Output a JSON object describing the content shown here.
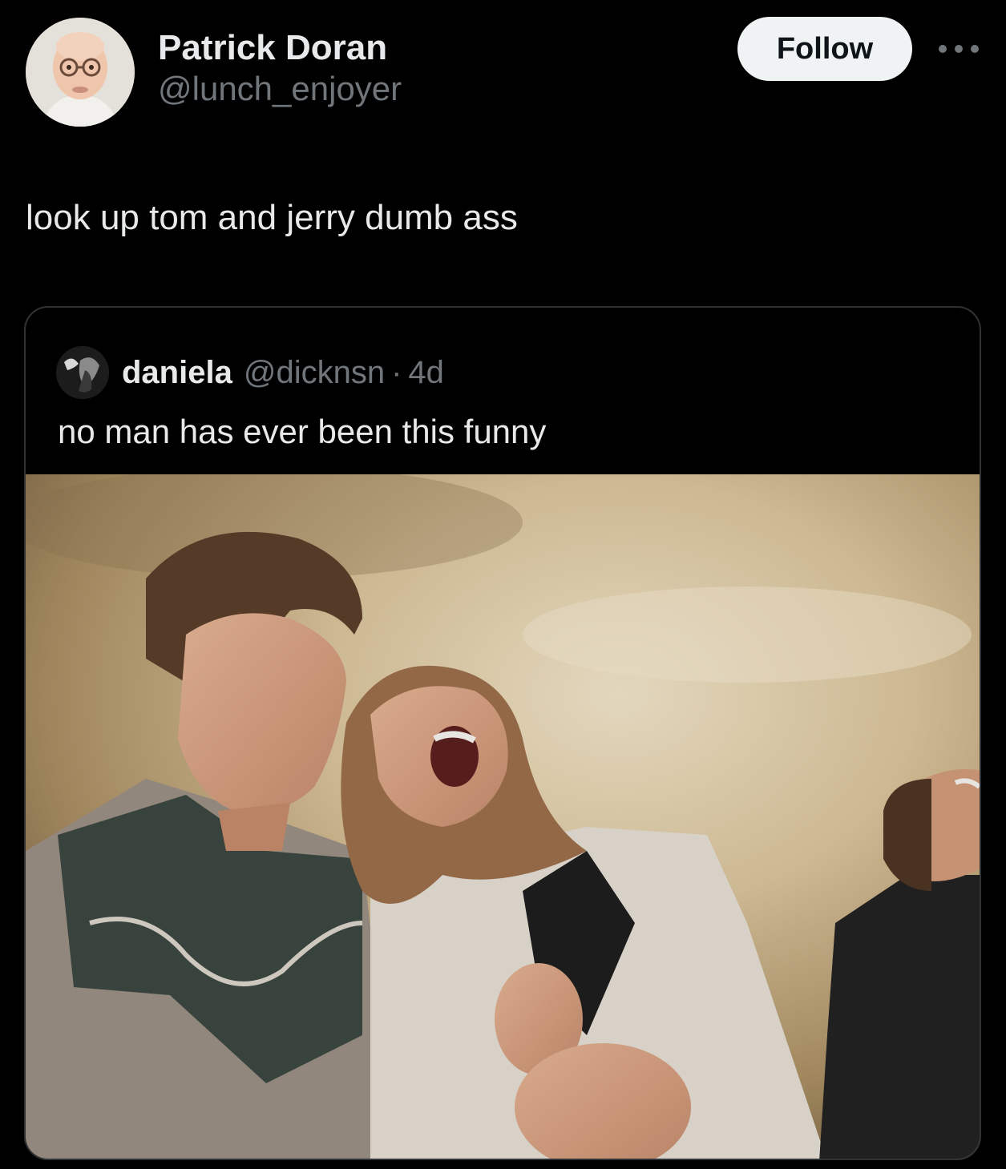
{
  "author": {
    "display_name": "Patrick Doran",
    "handle": "@lunch_enjoyer",
    "avatar_icon": "profile-photo-avatar"
  },
  "actions": {
    "follow_label": "Follow",
    "more_icon": "more-horizontal-icon"
  },
  "post": {
    "text": "look up tom and jerry dumb ass"
  },
  "quoted_post": {
    "display_name": "daniela",
    "handle": "@dicknsn",
    "separator": "·",
    "time": "4d",
    "text": "no man has ever been this funny",
    "media_icon": "photo-three-people-laughing"
  },
  "colors": {
    "background": "#000000",
    "text_primary": "#e7e9ea",
    "text_secondary": "#71767b",
    "follow_button_bg": "#eff3f4",
    "card_border": "#2f3336"
  }
}
